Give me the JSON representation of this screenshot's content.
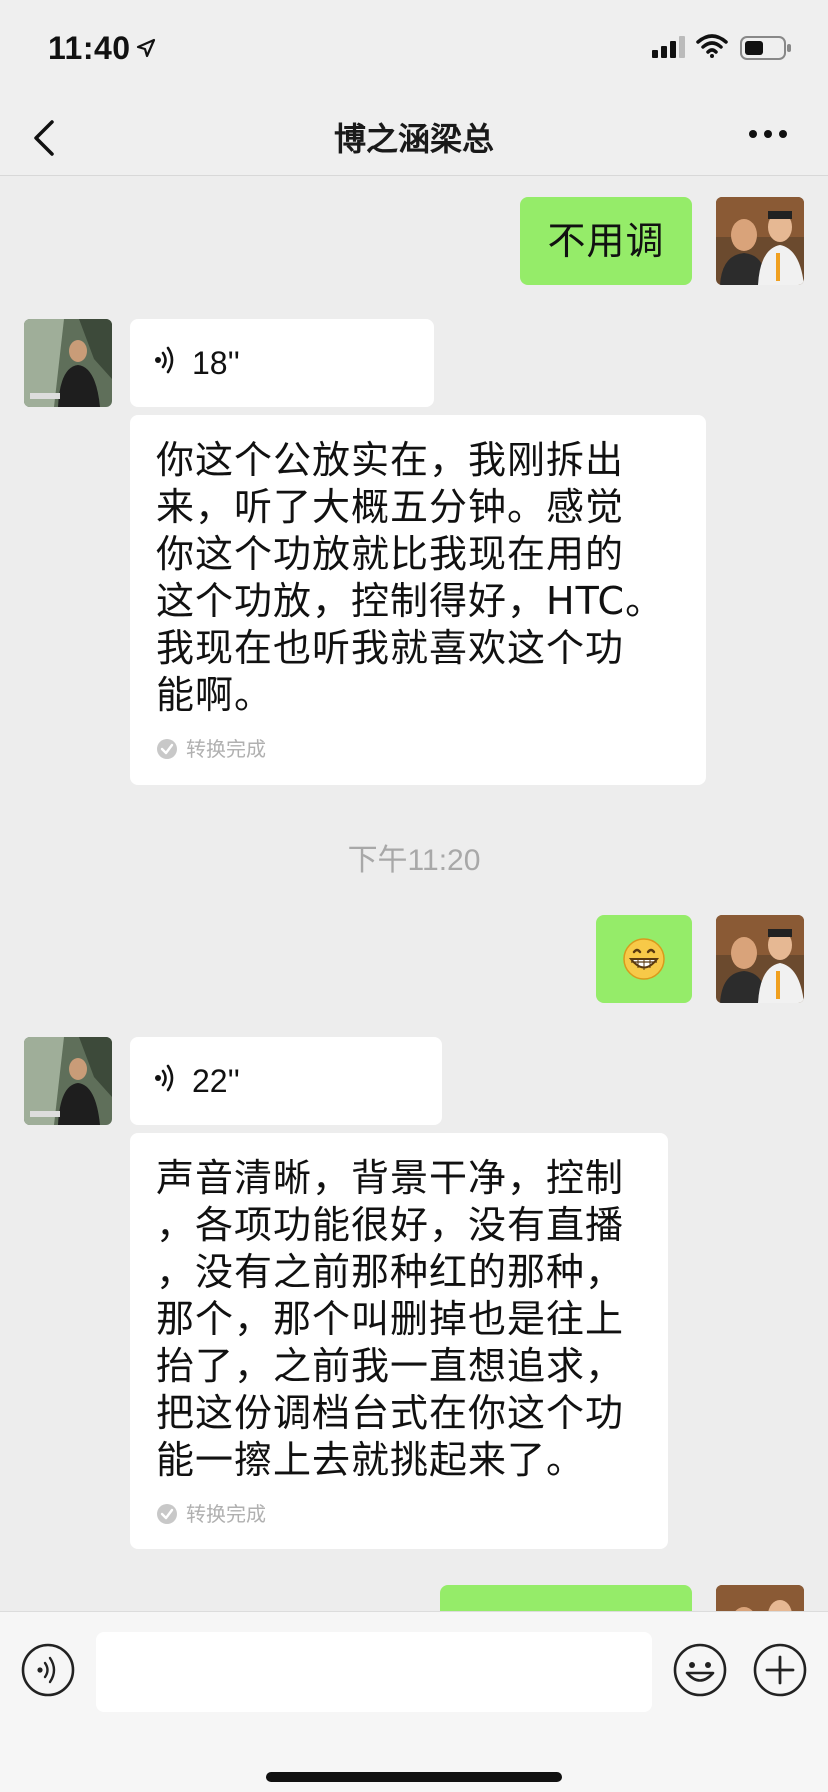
{
  "status_bar": {
    "time": "11:40",
    "icons": [
      "location-arrow-icon",
      "signal-icon",
      "wifi-icon",
      "battery-icon"
    ]
  },
  "nav": {
    "title": "博之涵梁总",
    "back_icon": "chevron-left-icon",
    "more_icon": "more-dots-icon"
  },
  "messages": [
    {
      "sender": "me",
      "type": "text",
      "text": "不用调"
    },
    {
      "sender": "other",
      "type": "voice",
      "duration": "18''"
    },
    {
      "sender": "other",
      "type": "transcript",
      "lines": [
        "你这个公放实在，我刚拆出",
        "来，听了大概五分钟。感觉",
        "你这个功放就比我现在用的",
        "这个功放，控制得好，HTC。",
        "我现在也听我就喜欢这个功",
        "能啊。"
      ],
      "status": "转换完成"
    },
    {
      "type": "timestamp",
      "text": "下午11:20"
    },
    {
      "sender": "me",
      "type": "emoji",
      "emoji": "grinning-face"
    },
    {
      "sender": "other",
      "type": "voice",
      "duration": "22''"
    },
    {
      "sender": "other",
      "type": "transcript",
      "lines": [
        "声音清晰，背景干净，控制",
        "，各项功能很好，没有直播",
        "，没有之前那种红的那种，",
        "那个，那个叫删掉也是往上",
        "抬了，之前我一直想追求，",
        "把这份调档台式在你这个功",
        "能一擦上去就挑起来了。"
      ],
      "status": "转换完成"
    }
  ],
  "input_bar": {
    "voice_icon": "voice-input-icon",
    "placeholder": "",
    "emoji_icon": "emoji-face-icon",
    "plus_icon": "plus-circle-icon"
  },
  "colors": {
    "my_bubble": "#95ec69",
    "other_bubble": "#ffffff",
    "background": "#ededed"
  }
}
